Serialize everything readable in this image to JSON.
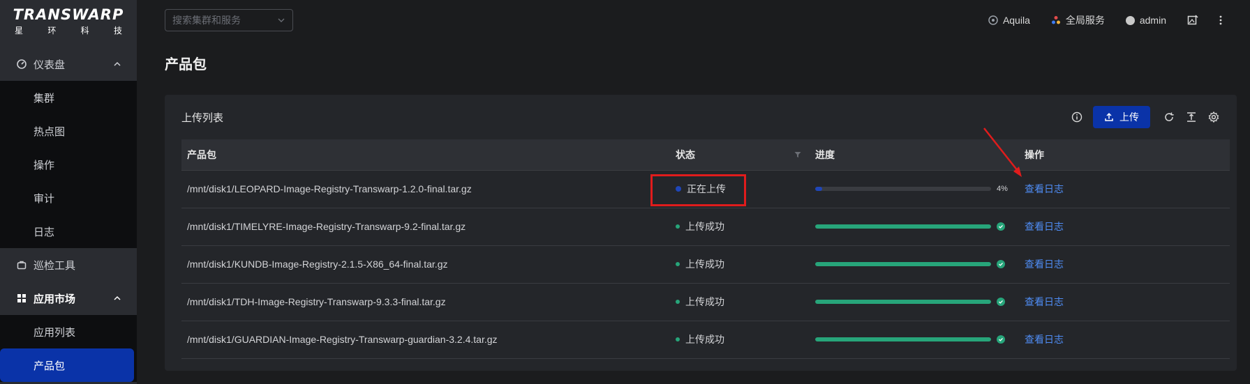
{
  "brand": {
    "name": "TRANSWARP",
    "subtitle": "星 环 科 技"
  },
  "sidebar": {
    "dashboard": {
      "label": "仪表盘",
      "items": [
        "集群",
        "热点图",
        "操作",
        "审计",
        "日志"
      ]
    },
    "inspect": {
      "label": "巡检工具"
    },
    "market": {
      "label": "应用市场",
      "items": [
        "应用列表",
        "产品包"
      ]
    }
  },
  "search": {
    "placeholder": "搜索集群和服务"
  },
  "topbar": {
    "aquila": "Aquila",
    "services": "全局服务",
    "user": "admin"
  },
  "page": {
    "title": "产品包"
  },
  "panel": {
    "title": "上传列表",
    "upload_label": "上传"
  },
  "table": {
    "headers": {
      "package": "产品包",
      "status": "状态",
      "progress": "进度",
      "action": "操作"
    },
    "rows": [
      {
        "package": "/mnt/disk1/LEOPARD-Image-Registry-Transwarp-1.2.0-final.tar.gz",
        "status": "正在上传",
        "progress": 4,
        "progress_text": "4%",
        "action": "查看日志"
      },
      {
        "package": "/mnt/disk1/TIMELYRE-Image-Registry-Transwarp-9.2-final.tar.gz",
        "status": "上传成功",
        "progress": 100,
        "action": "查看日志"
      },
      {
        "package": "/mnt/disk1/KUNDB-Image-Registry-2.1.5-X86_64-final.tar.gz",
        "status": "上传成功",
        "progress": 100,
        "action": "查看日志"
      },
      {
        "package": "/mnt/disk1/TDH-Image-Registry-Transwarp-9.3.3-final.tar.gz",
        "status": "上传成功",
        "progress": 100,
        "action": "查看日志"
      },
      {
        "package": "/mnt/disk1/GUARDIAN-Image-Registry-Transwarp-guardian-3.2.4.tar.gz",
        "status": "上传成功",
        "progress": 100,
        "action": "查看日志"
      }
    ]
  },
  "colors": {
    "primary": "#0a33a8",
    "success": "#27a57a",
    "link": "#4f8df5",
    "highlight": "#e01c1c"
  }
}
